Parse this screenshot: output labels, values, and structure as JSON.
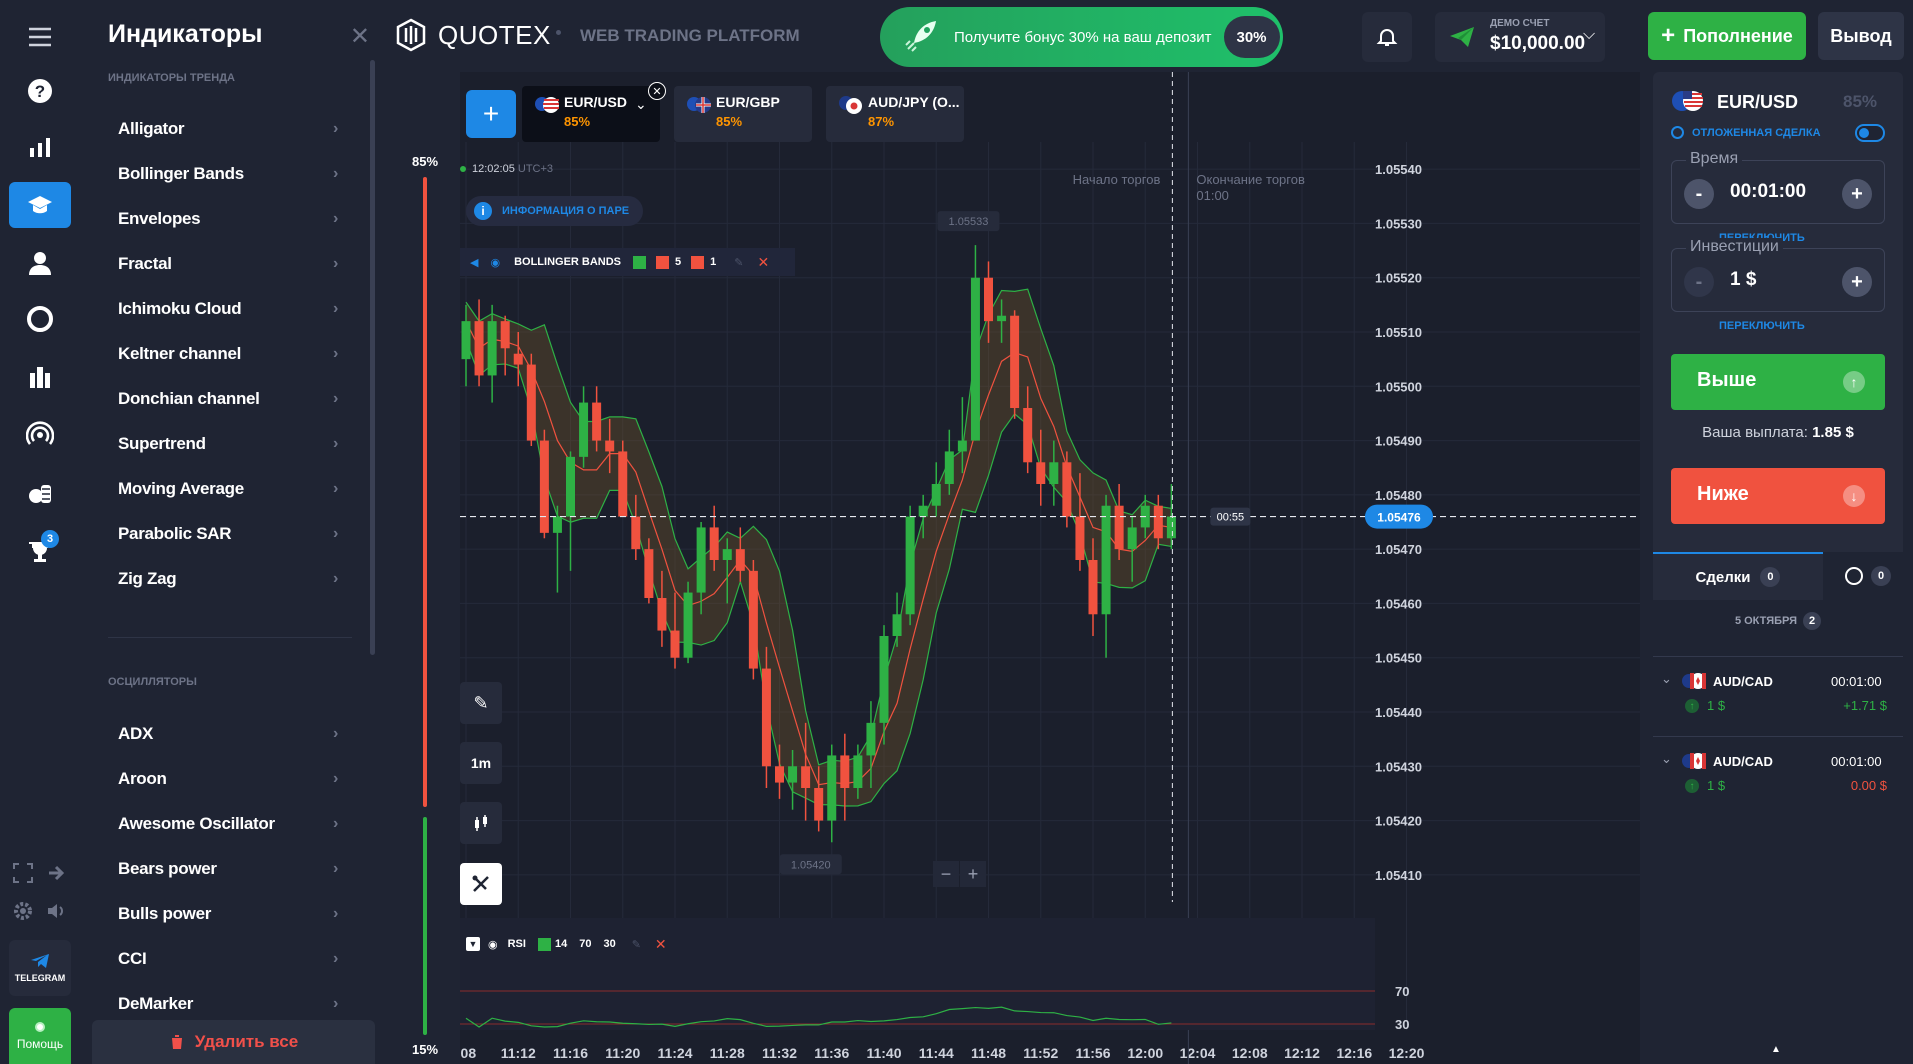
{
  "rail": {
    "items": [
      {
        "icon": "menu-icon"
      },
      {
        "icon": "help-icon"
      },
      {
        "icon": "chart-bars-icon"
      },
      {
        "icon": "education-icon",
        "active": true
      },
      {
        "icon": "user-icon"
      },
      {
        "icon": "refresh-circle-icon"
      },
      {
        "icon": "market-icon"
      },
      {
        "icon": "signal-icon"
      },
      {
        "icon": "coins-icon"
      },
      {
        "icon": "trophy-icon",
        "badge": "3"
      }
    ],
    "telegram_label": "TELEGRAM",
    "help_label": "Помощь"
  },
  "indicators": {
    "title": "Индикаторы",
    "trend_section": "Индикаторы тренда",
    "trend": [
      "Alligator",
      "Bollinger Bands",
      "Envelopes",
      "Fractal",
      "Ichimoku Cloud",
      "Keltner channel",
      "Donchian channel",
      "Supertrend",
      "Moving Average",
      "Parabolic SAR",
      "Zig Zag"
    ],
    "osc_section": "Осцилляторы",
    "oscillators": [
      "ADX",
      "Aroon",
      "Awesome Oscillator",
      "Bears power",
      "Bulls power",
      "CCI",
      "DeMarker"
    ],
    "delete_all": "Удалить все"
  },
  "header": {
    "logo": "QUOTEX",
    "subtitle": "WEB TRADING PLATFORM",
    "promo_text": "Получите бонус 30% на ваш депозит",
    "promo_badge": "30%",
    "account_label": "ДЕМО СЧЕТ",
    "balance": "$10,000.00",
    "deposit_label": "Пополнение",
    "withdraw_label": "Вывод"
  },
  "chart": {
    "tabs": [
      {
        "pair": "EUR/USD",
        "payout": "85%",
        "active": true
      },
      {
        "pair": "EUR/GBP",
        "payout": "85%"
      },
      {
        "pair": "AUD/JPY (O...",
        "payout": "87%"
      }
    ],
    "time": "12:02:05",
    "tz": "UTC+3",
    "pair_info": "ИНФОРМАЦИЯ О ПАРЕ",
    "bb_label": "BOLLINGER BANDS",
    "bb_params": [
      "5",
      "1"
    ],
    "start_label": "Начало торгов",
    "end_label": "Окончание торгов",
    "end_time": "01:00",
    "current_price": "1.05476",
    "countdown": "00:55",
    "high_label": "1.05533",
    "low_label": "1.05420",
    "timeframe": "1m",
    "sentiment_up": "85%",
    "sentiment_down": "15%",
    "rsi_label": "RSI",
    "rsi_params": [
      "14",
      "70",
      "30"
    ],
    "rsi_levels": [
      "70",
      "30"
    ],
    "price_axis": [
      "1.05540",
      "1.05530",
      "1.05520",
      "1.05510",
      "1.05500",
      "1.05490",
      "1.05480",
      "1.05470",
      "1.05460",
      "1.05450",
      "1.05440",
      "1.05430",
      "1.05420",
      "1.05410"
    ],
    "time_axis": [
      ":08",
      "11:12",
      "11:16",
      "11:20",
      "11:24",
      "11:28",
      "11:32",
      "11:36",
      "11:40",
      "11:44",
      "11:48",
      "11:52",
      "11:56",
      "12:00",
      "12:04",
      "12:08",
      "12:12",
      "12:16",
      "12:20"
    ]
  },
  "chart_data": {
    "type": "candlestick",
    "x_start": "11:08",
    "interval_minutes": 1,
    "ohlc": [
      [
        1.05505,
        1.05515,
        1.055,
        1.05512
      ],
      [
        1.05512,
        1.05516,
        1.055,
        1.05502
      ],
      [
        1.05502,
        1.05515,
        1.05497,
        1.05512
      ],
      [
        1.05512,
        1.05513,
        1.05502,
        1.05507
      ],
      [
        1.05506,
        1.0551,
        1.055,
        1.05504
      ],
      [
        1.05504,
        1.05506,
        1.05489,
        1.0549
      ],
      [
        1.0549,
        1.05492,
        1.05472,
        1.05473
      ],
      [
        1.05473,
        1.05478,
        1.05462,
        1.05476
      ],
      [
        1.05476,
        1.05488,
        1.05466,
        1.05487
      ],
      [
        1.05487,
        1.055,
        1.05485,
        1.05497
      ],
      [
        1.05497,
        1.055,
        1.05488,
        1.0549
      ],
      [
        1.0549,
        1.05494,
        1.05484,
        1.05488
      ],
      [
        1.05488,
        1.0549,
        1.05476,
        1.05476
      ],
      [
        1.05476,
        1.0548,
        1.05468,
        1.0547
      ],
      [
        1.0547,
        1.05472,
        1.0546,
        1.05461
      ],
      [
        1.05461,
        1.05466,
        1.05452,
        1.05455
      ],
      [
        1.05455,
        1.05462,
        1.05448,
        1.0545
      ],
      [
        1.0545,
        1.05464,
        1.05449,
        1.05462
      ],
      [
        1.05462,
        1.05475,
        1.05458,
        1.05474
      ],
      [
        1.05474,
        1.05478,
        1.05466,
        1.05468
      ],
      [
        1.05468,
        1.05472,
        1.0546,
        1.0547
      ],
      [
        1.0547,
        1.05474,
        1.05464,
        1.05466
      ],
      [
        1.05466,
        1.05468,
        1.05446,
        1.05448
      ],
      [
        1.05448,
        1.05452,
        1.05426,
        1.0543
      ],
      [
        1.0543,
        1.05434,
        1.05424,
        1.05427
      ],
      [
        1.05427,
        1.05433,
        1.05422,
        1.0543
      ],
      [
        1.0543,
        1.05438,
        1.0542,
        1.05426
      ],
      [
        1.05426,
        1.0543,
        1.05418,
        1.0542
      ],
      [
        1.0542,
        1.05434,
        1.05416,
        1.05432
      ],
      [
        1.05432,
        1.05436,
        1.0542,
        1.05426
      ],
      [
        1.05426,
        1.05434,
        1.05424,
        1.05432
      ],
      [
        1.05432,
        1.05442,
        1.05426,
        1.05438
      ],
      [
        1.05438,
        1.05456,
        1.05434,
        1.05454
      ],
      [
        1.05454,
        1.05462,
        1.05452,
        1.05458
      ],
      [
        1.05458,
        1.05478,
        1.05456,
        1.05476
      ],
      [
        1.05476,
        1.0548,
        1.05472,
        1.05478
      ],
      [
        1.05478,
        1.05486,
        1.05476,
        1.05482
      ],
      [
        1.05482,
        1.05492,
        1.0548,
        1.05488
      ],
      [
        1.05488,
        1.05498,
        1.05484,
        1.0549
      ],
      [
        1.0549,
        1.05526,
        1.0549,
        1.0552
      ],
      [
        1.0552,
        1.05523,
        1.05508,
        1.05512
      ],
      [
        1.05512,
        1.05516,
        1.05508,
        1.05513
      ],
      [
        1.05513,
        1.05514,
        1.05494,
        1.05496
      ],
      [
        1.05496,
        1.055,
        1.05484,
        1.05486
      ],
      [
        1.05486,
        1.05492,
        1.05478,
        1.05482
      ],
      [
        1.05482,
        1.0549,
        1.05478,
        1.05486
      ],
      [
        1.05486,
        1.05488,
        1.05474,
        1.05476
      ],
      [
        1.05476,
        1.05484,
        1.05466,
        1.05468
      ],
      [
        1.05468,
        1.05472,
        1.05454,
        1.05458
      ],
      [
        1.05458,
        1.0548,
        1.0545,
        1.05478
      ],
      [
        1.05478,
        1.05482,
        1.05468,
        1.0547
      ],
      [
        1.0547,
        1.05476,
        1.05464,
        1.05474
      ],
      [
        1.05474,
        1.0548,
        1.05472,
        1.05478
      ],
      [
        1.05478,
        1.0548,
        1.0547,
        1.05472
      ],
      [
        1.05472,
        1.05482,
        1.0547,
        1.05476
      ]
    ],
    "ylim": [
      1.05405,
      1.05545
    ],
    "rsi_levels": [
      70,
      30
    ]
  },
  "trade_panel": {
    "pair": "EUR/USD",
    "payout": "85%",
    "pending": "ОТЛОЖЕННАЯ СДЕЛКА",
    "time_label": "Время",
    "time_value": "00:01:00",
    "switch_label": "ПЕРЕКЛЮЧИТЬ",
    "invest_label": "Инвестиции",
    "invest_value": "1 $",
    "up_label": "Выше",
    "payout_label": "Ваша выплата:",
    "payout_value": "1.85 $",
    "down_label": "Ниже"
  },
  "trades": {
    "tab_label": "Сделки",
    "tab_count": "0",
    "history_count": "0",
    "date_label": "5 октября",
    "date_count": "2",
    "items": [
      {
        "pair": "AUD/CAD",
        "duration": "00:01:00",
        "amount": "1 $",
        "result": "+1.71 $",
        "win": true
      },
      {
        "pair": "AUD/CAD",
        "duration": "00:01:00",
        "amount": "1 $",
        "result": "0.00 $",
        "win": false
      }
    ]
  },
  "colors": {
    "up": "#2eb145",
    "down": "#f0523f",
    "accent": "#1e88e5",
    "bg": "#1f2433"
  }
}
